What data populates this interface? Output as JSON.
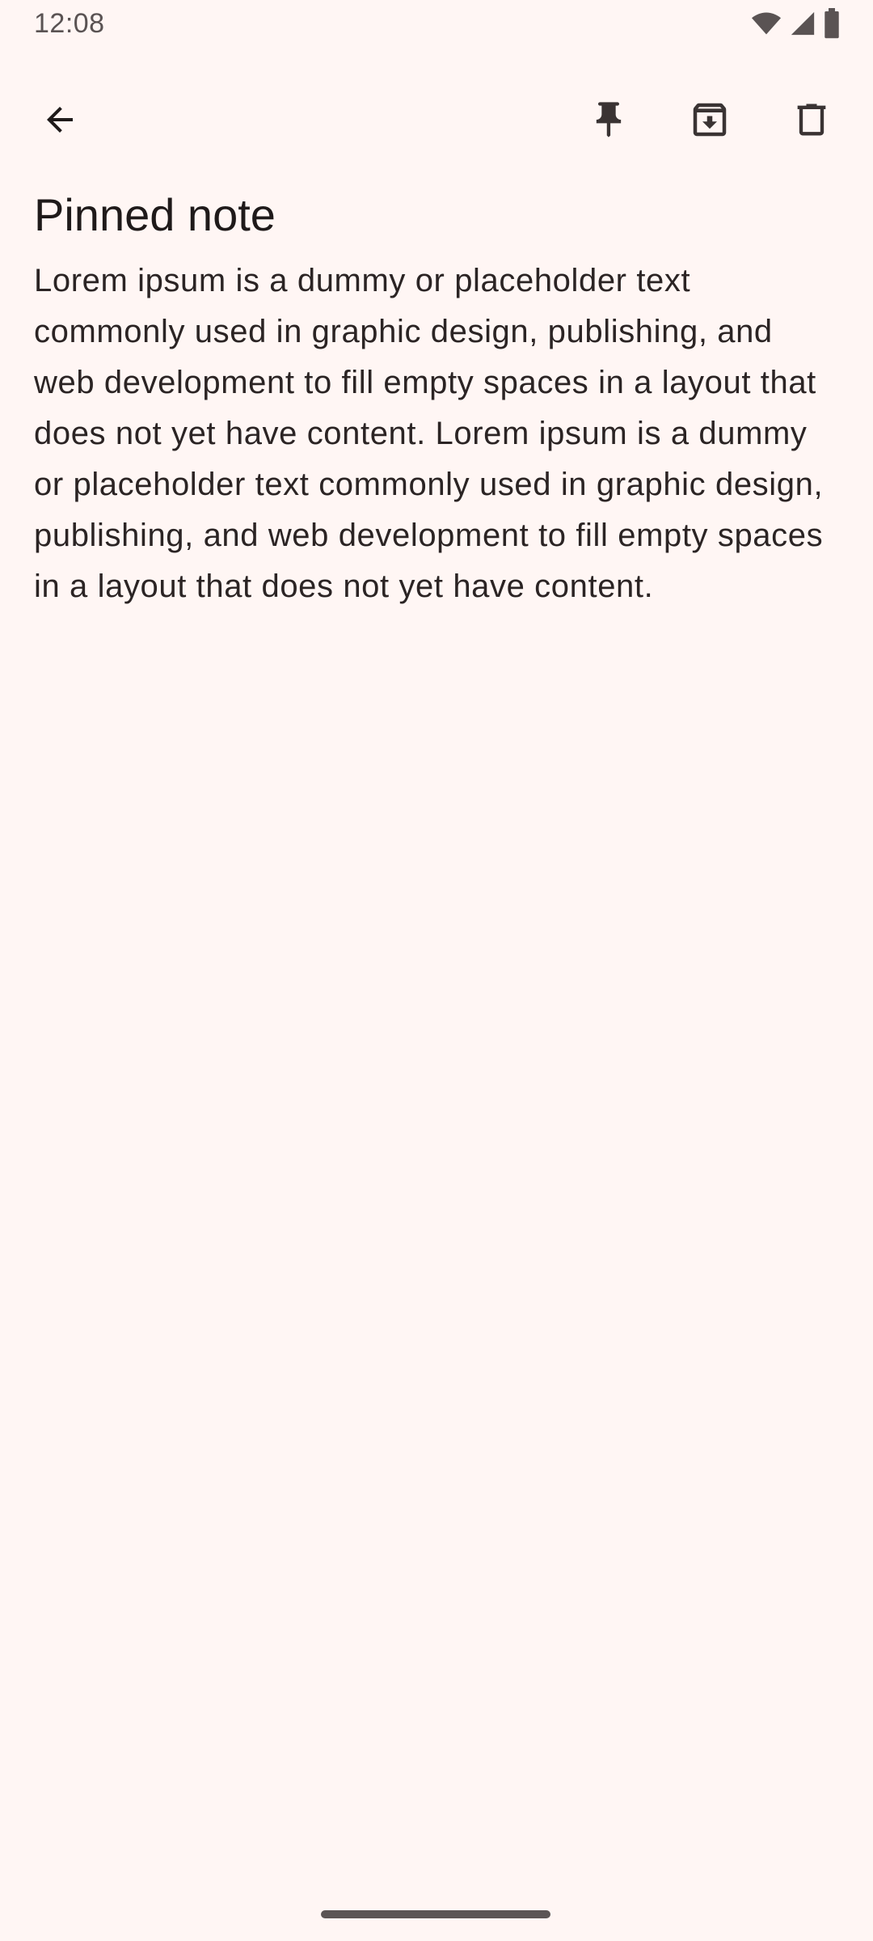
{
  "status_bar": {
    "time": "12:08",
    "icons": [
      "wifi-icon",
      "cellular-signal-icon",
      "battery-icon"
    ]
  },
  "toolbar": {
    "back_icon": "arrow-back-icon",
    "pin_icon": "pin-icon",
    "archive_icon": "archive-icon",
    "delete_icon": "trash-icon"
  },
  "note": {
    "title": "Pinned note",
    "body": "Lorem ipsum is a dummy or placeholder text commonly used in graphic design, publishing, and web development to fill empty spaces in a layout that does not yet have content. Lorem ipsum is a dummy or placeholder text commonly used in graphic design, publishing, and web development to fill empty spaces in a layout that does not yet have content."
  },
  "colors": {
    "background": "#fff6f4",
    "text": "#1f1a1a",
    "icon": "#3a3333"
  }
}
